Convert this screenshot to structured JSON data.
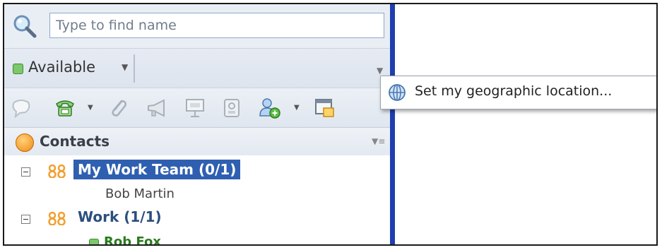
{
  "search": {
    "placeholder": "Type to find name"
  },
  "status": {
    "label": "Available"
  },
  "toolbar": {
    "icons": [
      "chat-icon",
      "phone-icon",
      "attach-icon",
      "announce-icon",
      "present-icon",
      "screen-icon",
      "add-contact-icon",
      "new-window-icon"
    ]
  },
  "contacts": {
    "title": "Contacts",
    "groups": [
      {
        "name": "My Work Team (0/1)",
        "members": [
          "Bob Martin"
        ]
      },
      {
        "name": "Work (1/1)",
        "members": [
          "Rob Fox"
        ]
      }
    ]
  },
  "menu": {
    "items": [
      {
        "label": "Set my geographic location...",
        "icon": "globe-icon"
      }
    ]
  },
  "colors": {
    "selection": "#2f5fb0",
    "online": "#7cc86a",
    "divider": "#1f3fb0"
  }
}
